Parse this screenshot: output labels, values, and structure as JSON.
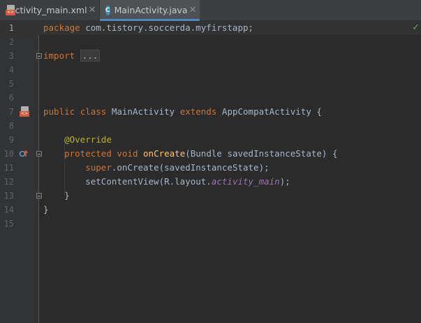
{
  "tabs": [
    {
      "label": "activity_main.xml",
      "icon": "xml-file-icon",
      "badge": "<>",
      "active": false
    },
    {
      "label": "MainActivity.java",
      "icon": "class-icon",
      "badge": "C",
      "active": true
    }
  ],
  "close_glyph": "✕",
  "status_check": "✓",
  "lines": {
    "ln1": "1",
    "ln2": "2",
    "ln3": "3",
    "ln4": "4",
    "ln5": "5",
    "ln6": "6",
    "ln7": "7",
    "ln8": "8",
    "ln9": "9",
    "ln10": "10",
    "ln11": "11",
    "ln12": "12",
    "ln13": "13",
    "ln14": "14",
    "ln15": "15"
  },
  "code": {
    "l1_kw": "package",
    "l1_pkg": " com.tistory.soccerda.myfirstapp;",
    "l3_kw": "import",
    "l3_fold": "...",
    "l7_kw1": "public",
    "l7_kw2": "class",
    "l7_name": "MainActivity",
    "l7_kw3": "extends",
    "l7_super": "AppCompatActivity {",
    "l9_ann": "@Override",
    "l10_kw1": "protected",
    "l10_kw2": "void",
    "l10_fn": "onCreate",
    "l10_params": "(Bundle savedInstanceState) {",
    "l11_kw": "super",
    "l11_rest": ".onCreate(savedInstanceState);",
    "l12_call": "setContentView(R.layout.",
    "l12_field": "activity_main",
    "l12_end": ");",
    "l13": "}",
    "l14": "}"
  },
  "colors": {
    "background": "#2b2b2b",
    "keyword": "#cc7832",
    "annotation": "#bbb529",
    "function": "#ffc66d",
    "field": "#9876aa",
    "text": "#a9b7c6",
    "check": "#59a869"
  }
}
